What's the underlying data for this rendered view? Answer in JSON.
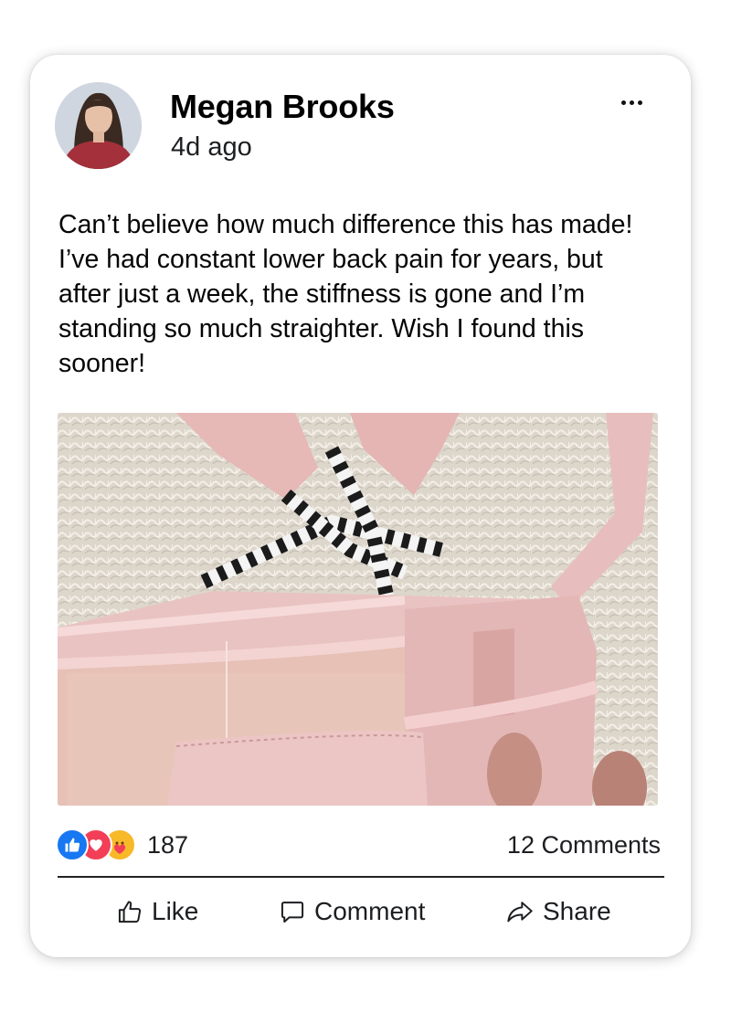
{
  "post": {
    "author": "Megan Brooks",
    "time": "4d ago",
    "text": "Can’t believe how much difference this has made! I’ve had constant lower back pain for years, but after just a week, the stiffness is gone and I’m standing so much straighter. Wish I found this sooner!",
    "image_icon": "photo-back-brace"
  },
  "reactions": {
    "icons": [
      "like-icon",
      "love-icon",
      "care-icon"
    ],
    "count": "187"
  },
  "comments_count": "12 Comments",
  "actions": {
    "like": "Like",
    "comment": "Comment",
    "share": "Share"
  },
  "colors": {
    "like_blue": "#1877f2",
    "love_red": "#f33e58",
    "care_yellow": "#f7b928",
    "brace_pink": "#e8c1c0"
  }
}
